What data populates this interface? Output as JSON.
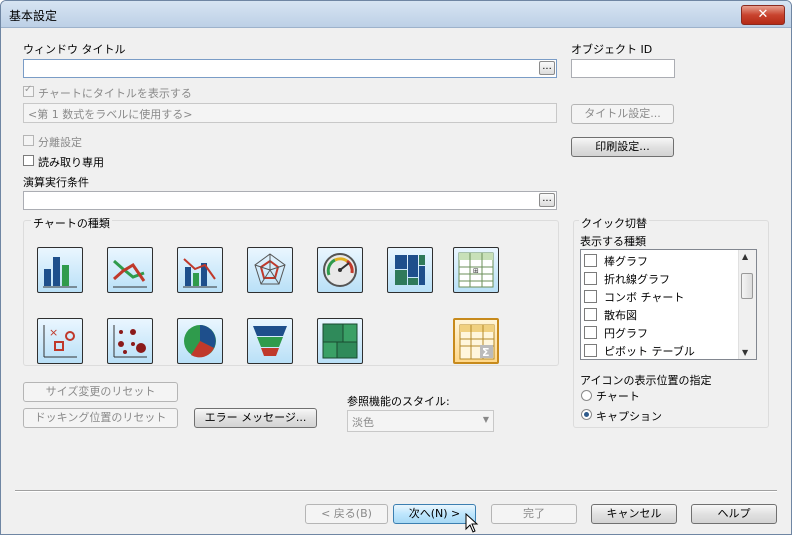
{
  "window": {
    "title": "基本設定",
    "close_icon": "close-icon"
  },
  "window_title": {
    "label": "ウィンドウ タイトル",
    "value": ""
  },
  "object_id": {
    "label": "オブジェクト ID",
    "value": ""
  },
  "show_title": {
    "label": "チャートにタイトルを表示する",
    "checked": true,
    "enabled": false
  },
  "title_expression": {
    "value": "<第 1 数式をラベルに使用する>"
  },
  "title_settings_button": "タイトル設定...",
  "detached": {
    "label": "分離設定",
    "checked": false
  },
  "read_only": {
    "label": "読み取り専用",
    "checked": false
  },
  "print_settings_button": "印刷設定...",
  "calc_condition": {
    "label": "演算実行条件",
    "value": ""
  },
  "chart_types": {
    "label": "チャートの種類",
    "items": [
      {
        "name": "bar-chart-icon"
      },
      {
        "name": "line-chart-icon"
      },
      {
        "name": "combo-chart-icon"
      },
      {
        "name": "radar-chart-icon"
      },
      {
        "name": "gauge-chart-icon"
      },
      {
        "name": "mekko-chart-icon"
      },
      {
        "name": "pivot-table-icon"
      },
      {
        "name": "scatter-chart-icon"
      },
      {
        "name": "grid-chart-icon"
      },
      {
        "name": "pie-chart-icon"
      },
      {
        "name": "funnel-chart-icon"
      },
      {
        "name": "block-chart-icon"
      },
      {
        "name": "straight-table-icon",
        "selected": true
      }
    ]
  },
  "quick_change": {
    "label": "クイック切替",
    "types_label": "表示する種類",
    "items": [
      {
        "label": "棒グラフ",
        "checked": false
      },
      {
        "label": "折れ線グラフ",
        "checked": false
      },
      {
        "label": "コンボ チャート",
        "checked": false
      },
      {
        "label": "散布図",
        "checked": false
      },
      {
        "label": "円グラフ",
        "checked": false
      },
      {
        "label": "ピボット テーブル",
        "checked": false
      }
    ],
    "icon_position_label": "アイコンの表示位置の指定",
    "position_options": [
      {
        "label": "チャート",
        "selected": false
      },
      {
        "label": "キャプション",
        "selected": true
      }
    ]
  },
  "reset_size_button": "サイズ変更のリセット",
  "reset_docking_button": "ドッキング位置のリセット",
  "error_messages_button": "エラー メッセージ...",
  "reference_style": {
    "label": "参照機能のスタイル:",
    "value": "淡色"
  },
  "footer": {
    "back": "< 戻る(B)",
    "next": "次へ(N) >",
    "finish": "完了",
    "cancel": "キャンセル",
    "help": "ヘルプ"
  },
  "colors": {
    "accent": "#3c7fb1",
    "selected_icon_border": "#c78a1c",
    "close_button": "#c8432e"
  }
}
